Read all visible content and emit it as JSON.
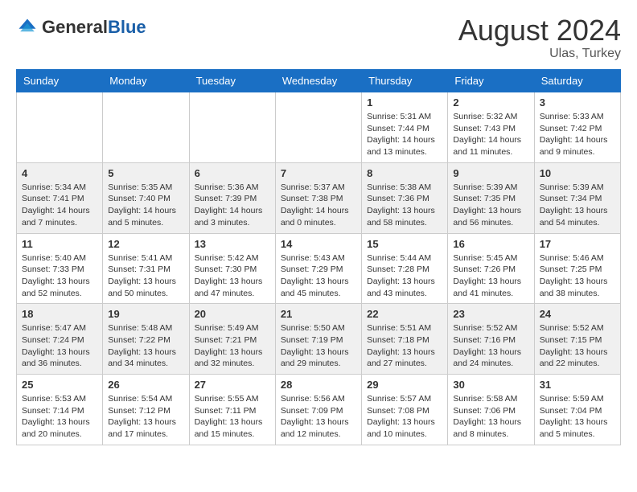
{
  "header": {
    "logo_general": "General",
    "logo_blue": "Blue",
    "month_title": "August 2024",
    "location": "Ulas, Turkey"
  },
  "days_of_week": [
    "Sunday",
    "Monday",
    "Tuesday",
    "Wednesday",
    "Thursday",
    "Friday",
    "Saturday"
  ],
  "weeks": [
    [
      {
        "day": "",
        "info": ""
      },
      {
        "day": "",
        "info": ""
      },
      {
        "day": "",
        "info": ""
      },
      {
        "day": "",
        "info": ""
      },
      {
        "day": "1",
        "info": "Sunrise: 5:31 AM\nSunset: 7:44 PM\nDaylight: 14 hours\nand 13 minutes."
      },
      {
        "day": "2",
        "info": "Sunrise: 5:32 AM\nSunset: 7:43 PM\nDaylight: 14 hours\nand 11 minutes."
      },
      {
        "day": "3",
        "info": "Sunrise: 5:33 AM\nSunset: 7:42 PM\nDaylight: 14 hours\nand 9 minutes."
      }
    ],
    [
      {
        "day": "4",
        "info": "Sunrise: 5:34 AM\nSunset: 7:41 PM\nDaylight: 14 hours\nand 7 minutes."
      },
      {
        "day": "5",
        "info": "Sunrise: 5:35 AM\nSunset: 7:40 PM\nDaylight: 14 hours\nand 5 minutes."
      },
      {
        "day": "6",
        "info": "Sunrise: 5:36 AM\nSunset: 7:39 PM\nDaylight: 14 hours\nand 3 minutes."
      },
      {
        "day": "7",
        "info": "Sunrise: 5:37 AM\nSunset: 7:38 PM\nDaylight: 14 hours\nand 0 minutes."
      },
      {
        "day": "8",
        "info": "Sunrise: 5:38 AM\nSunset: 7:36 PM\nDaylight: 13 hours\nand 58 minutes."
      },
      {
        "day": "9",
        "info": "Sunrise: 5:39 AM\nSunset: 7:35 PM\nDaylight: 13 hours\nand 56 minutes."
      },
      {
        "day": "10",
        "info": "Sunrise: 5:39 AM\nSunset: 7:34 PM\nDaylight: 13 hours\nand 54 minutes."
      }
    ],
    [
      {
        "day": "11",
        "info": "Sunrise: 5:40 AM\nSunset: 7:33 PM\nDaylight: 13 hours\nand 52 minutes."
      },
      {
        "day": "12",
        "info": "Sunrise: 5:41 AM\nSunset: 7:31 PM\nDaylight: 13 hours\nand 50 minutes."
      },
      {
        "day": "13",
        "info": "Sunrise: 5:42 AM\nSunset: 7:30 PM\nDaylight: 13 hours\nand 47 minutes."
      },
      {
        "day": "14",
        "info": "Sunrise: 5:43 AM\nSunset: 7:29 PM\nDaylight: 13 hours\nand 45 minutes."
      },
      {
        "day": "15",
        "info": "Sunrise: 5:44 AM\nSunset: 7:28 PM\nDaylight: 13 hours\nand 43 minutes."
      },
      {
        "day": "16",
        "info": "Sunrise: 5:45 AM\nSunset: 7:26 PM\nDaylight: 13 hours\nand 41 minutes."
      },
      {
        "day": "17",
        "info": "Sunrise: 5:46 AM\nSunset: 7:25 PM\nDaylight: 13 hours\nand 38 minutes."
      }
    ],
    [
      {
        "day": "18",
        "info": "Sunrise: 5:47 AM\nSunset: 7:24 PM\nDaylight: 13 hours\nand 36 minutes."
      },
      {
        "day": "19",
        "info": "Sunrise: 5:48 AM\nSunset: 7:22 PM\nDaylight: 13 hours\nand 34 minutes."
      },
      {
        "day": "20",
        "info": "Sunrise: 5:49 AM\nSunset: 7:21 PM\nDaylight: 13 hours\nand 32 minutes."
      },
      {
        "day": "21",
        "info": "Sunrise: 5:50 AM\nSunset: 7:19 PM\nDaylight: 13 hours\nand 29 minutes."
      },
      {
        "day": "22",
        "info": "Sunrise: 5:51 AM\nSunset: 7:18 PM\nDaylight: 13 hours\nand 27 minutes."
      },
      {
        "day": "23",
        "info": "Sunrise: 5:52 AM\nSunset: 7:16 PM\nDaylight: 13 hours\nand 24 minutes."
      },
      {
        "day": "24",
        "info": "Sunrise: 5:52 AM\nSunset: 7:15 PM\nDaylight: 13 hours\nand 22 minutes."
      }
    ],
    [
      {
        "day": "25",
        "info": "Sunrise: 5:53 AM\nSunset: 7:14 PM\nDaylight: 13 hours\nand 20 minutes."
      },
      {
        "day": "26",
        "info": "Sunrise: 5:54 AM\nSunset: 7:12 PM\nDaylight: 13 hours\nand 17 minutes."
      },
      {
        "day": "27",
        "info": "Sunrise: 5:55 AM\nSunset: 7:11 PM\nDaylight: 13 hours\nand 15 minutes."
      },
      {
        "day": "28",
        "info": "Sunrise: 5:56 AM\nSunset: 7:09 PM\nDaylight: 13 hours\nand 12 minutes."
      },
      {
        "day": "29",
        "info": "Sunrise: 5:57 AM\nSunset: 7:08 PM\nDaylight: 13 hours\nand 10 minutes."
      },
      {
        "day": "30",
        "info": "Sunrise: 5:58 AM\nSunset: 7:06 PM\nDaylight: 13 hours\nand 8 minutes."
      },
      {
        "day": "31",
        "info": "Sunrise: 5:59 AM\nSunset: 7:04 PM\nDaylight: 13 hours\nand 5 minutes."
      }
    ]
  ]
}
